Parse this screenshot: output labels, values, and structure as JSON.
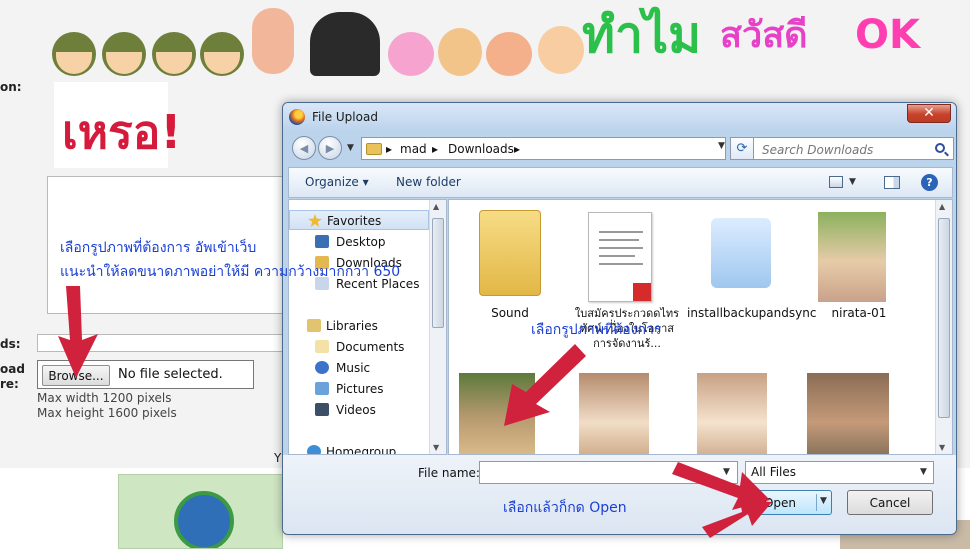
{
  "background_page": {
    "partial_labels": [
      "on:",
      "ds:",
      "oad",
      "re:"
    ],
    "big_words": [
      {
        "text": "ทำไม",
        "color": "#2bc04a"
      },
      {
        "text": "สวัสดี",
        "color": "#e642c8"
      },
      {
        "text": "OK",
        "color": "#ff3fb1"
      }
    ],
    "sticker_text": "เหรอ!",
    "browse_label": "Browse...",
    "no_file_text": "No file selected.",
    "max_width_text": "Max width 1200 pixels",
    "max_height_text": "Max height 1600 pixels",
    "partial_char": "Y"
  },
  "dialog": {
    "title": "File Upload",
    "close_glyph": "✕",
    "breadcrumbs": [
      "mad",
      "Downloads"
    ],
    "breadcrumb_sep": "▸",
    "search_placeholder": "Search Downloads",
    "toolbar": {
      "organize": "Organize ▾",
      "new_folder": "New folder",
      "help": "?"
    },
    "nav": {
      "favorites": "Favorites",
      "desktop": "Desktop",
      "downloads": "Downloads",
      "recent": "Recent Places",
      "libraries": "Libraries",
      "documents": "Documents",
      "music": "Music",
      "pictures": "Pictures",
      "videos": "Videos",
      "homegroup": "Homegroup"
    },
    "files": [
      {
        "name": "Sound"
      },
      {
        "name": "ใบสมัครประกวดดไทรทัศน์-เนื่องในโอกาสการจัดงานร้..."
      },
      {
        "name": "installbackupandsync"
      },
      {
        "name": "nirata-01"
      },
      {
        "name": ""
      },
      {
        "name": ""
      },
      {
        "name": ""
      },
      {
        "name": ""
      }
    ],
    "file_name_label": "File name:",
    "file_name_value": "",
    "filter": "All Files",
    "open_label": "Open",
    "cancel_label": "Cancel"
  },
  "annotations": {
    "top_line1": "เลือกรูปภาพที่ต้องการ อัพเข้าเว็บ",
    "top_line2": "แนะนำให้ลดขนาดภาพอย่าให้มี ความกว้างมากกว่า 650",
    "middle": "เลือกรูปภาพที่ต้องการ",
    "bottom": "เลือกแล้วก็กด Open"
  },
  "colors": {
    "annotation_text": "#1a3fd6",
    "annotation_arrow": "#d0223c",
    "dialog_frame": "#bcd3ec",
    "open_button": "#bee6fd"
  }
}
